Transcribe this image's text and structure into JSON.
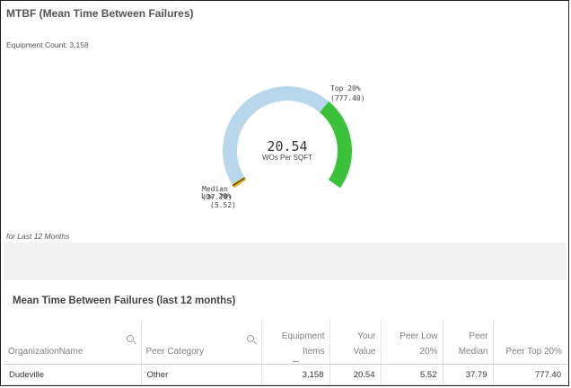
{
  "card": {
    "title": "MTBF (Mean Time Between Failures)",
    "equipment_count": "Equipment Count: 3,158",
    "period": "for Last 12 Months"
  },
  "gauge": {
    "value_label": "20.54",
    "unit": "WOs Per SQFT",
    "value": 20.54,
    "min": 0,
    "max": 777.4,
    "track_color": "#b9d7ea",
    "top_color": "#3cc13b",
    "low_color": "#e6b21a",
    "median_color": "#333333",
    "top_label": "Top 20%",
    "top_value": "(777.40)",
    "median_label": "Median",
    "median_value": "(37.79)",
    "low_label": "Low 20%",
    "low_value": "(5.52)"
  },
  "table": {
    "title": "Mean Time Between Failures (last 12 months)",
    "columns": [
      "OrganizationName",
      "Peer Category",
      "Equipment Items",
      "Your Value",
      "Peer Low 20%",
      "Peer Median",
      "Peer Top 20%"
    ],
    "rows": [
      [
        "Dudeville",
        "Other",
        "3,158",
        "20.54",
        "5.52",
        "37.79",
        "777.40"
      ]
    ]
  }
}
